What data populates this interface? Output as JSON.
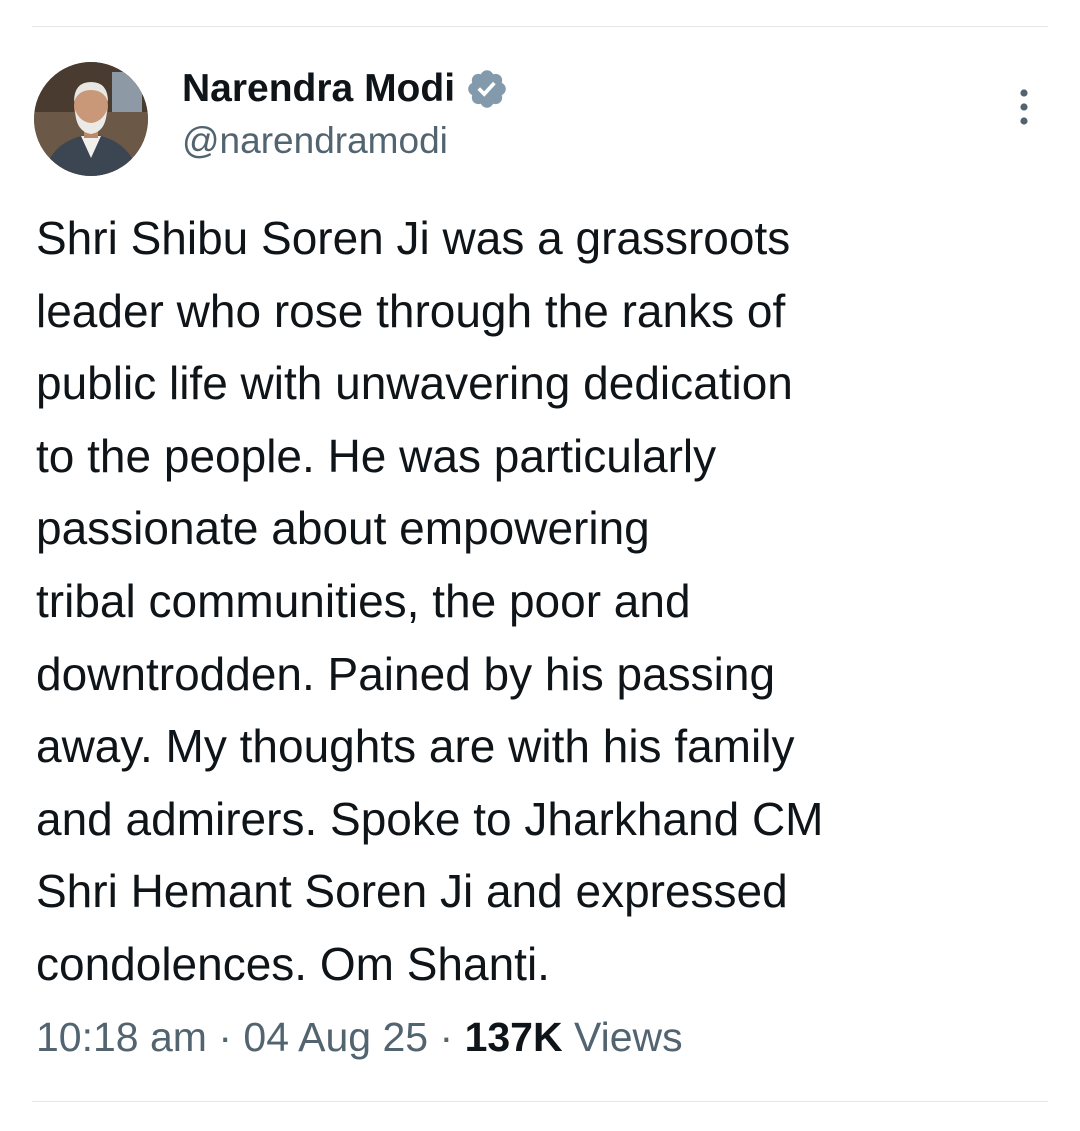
{
  "author": {
    "display_name": "Narendra Modi",
    "handle": "@narendramodi",
    "verified": true,
    "avatar_icon": "profile-photo"
  },
  "menu": {
    "icon": "more-vertical-icon"
  },
  "tweet": {
    "lines": [
      "Shri Shibu Soren Ji was a grassroots",
      "leader who rose through the ranks of",
      "public life with unwavering dedication",
      "to the people. He was particularly",
      "passionate about empowering",
      "tribal communities, the poor and",
      "downtrodden. Pained by his passing",
      "away. My thoughts are with his family",
      "and admirers. Spoke to Jharkhand CM",
      "Shri Hemant Soren Ji and expressed",
      "condolences. Om Shanti."
    ]
  },
  "meta": {
    "time": "10:18 am",
    "separator": "·",
    "date": "04 Aug 25",
    "views_count": "137K",
    "views_label": "Views"
  },
  "colors": {
    "text_primary": "#0f1419",
    "text_secondary": "#536471",
    "verified_badge": "#829aab",
    "divider": "#e3e6e8"
  }
}
